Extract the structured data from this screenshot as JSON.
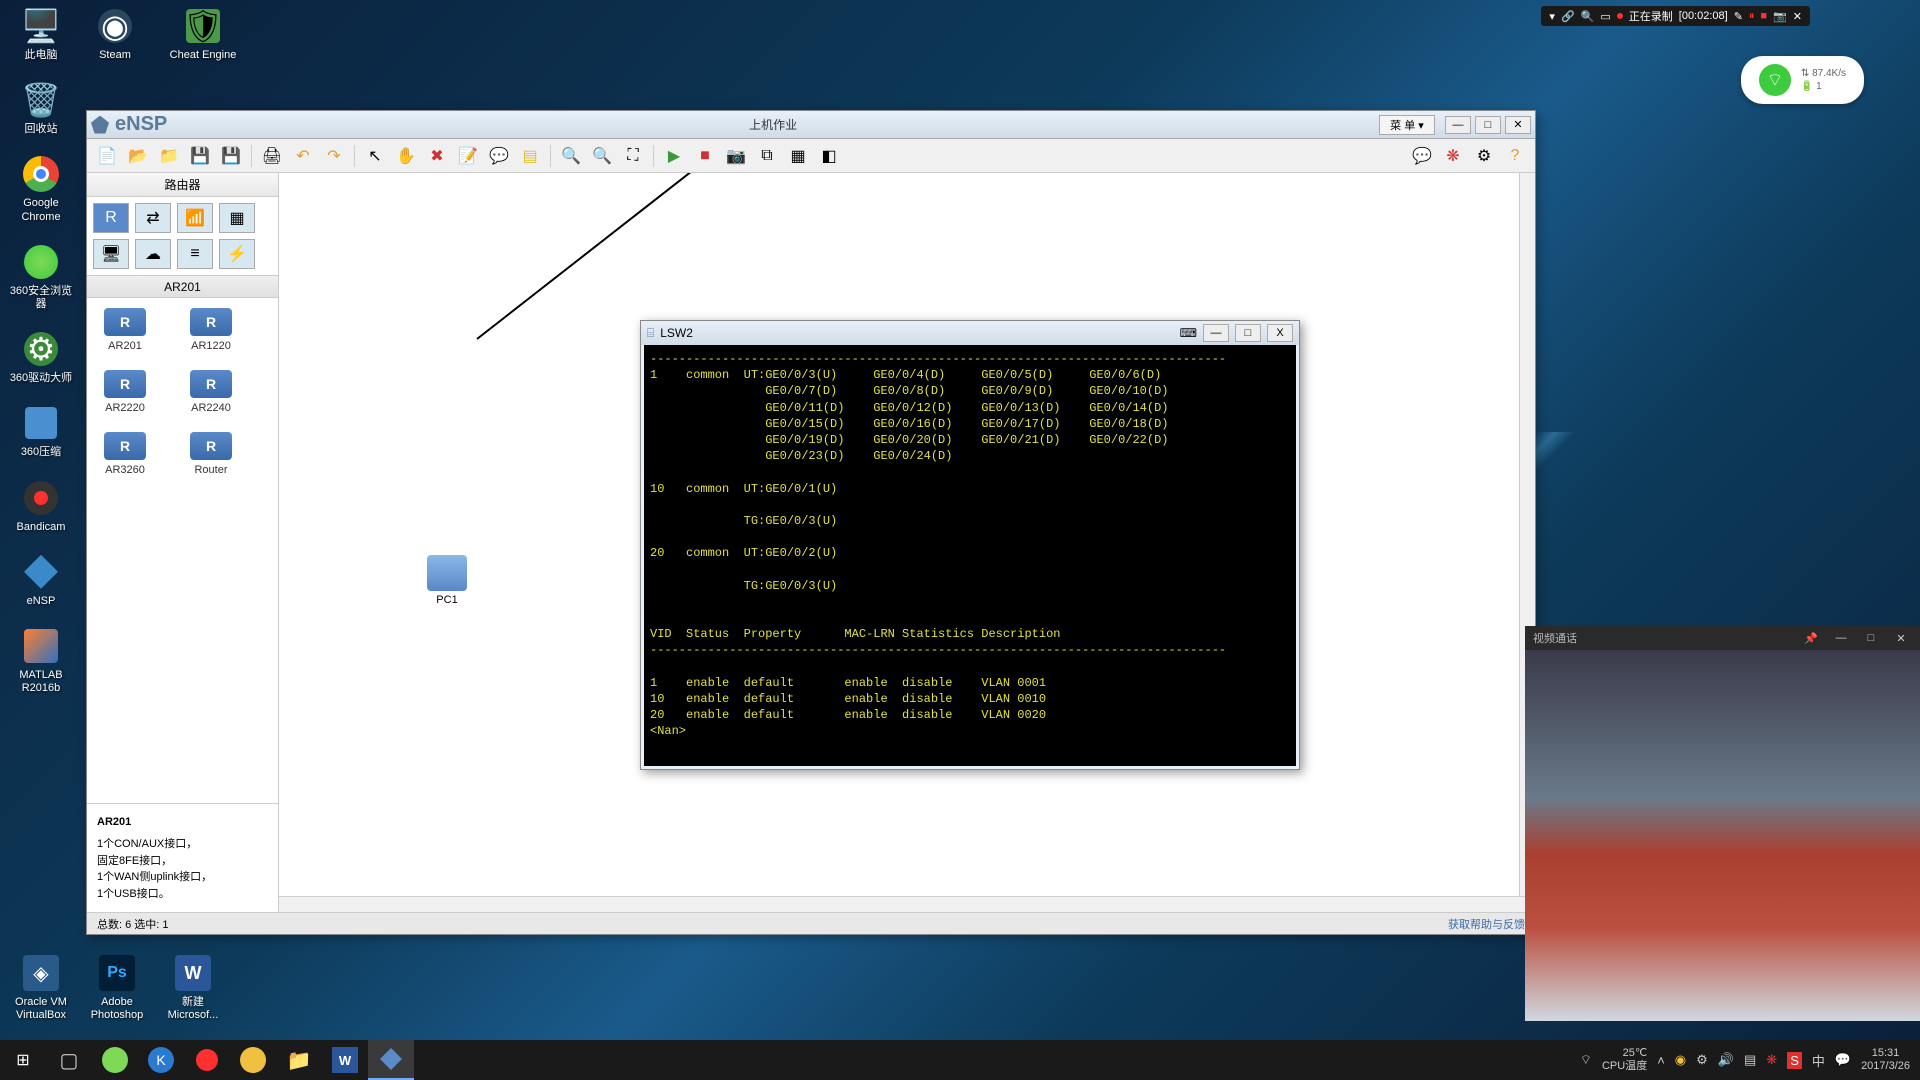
{
  "desktop": {
    "icons_col1": [
      {
        "label": "此电脑",
        "glyph": "🖥️"
      },
      {
        "label": "回收站",
        "glyph": "🗑️"
      },
      {
        "label": "Google Chrome",
        "glyph": "🟡"
      },
      {
        "label": "360安全浏览器",
        "glyph": "🟢"
      },
      {
        "label": "360驱动大师",
        "glyph": "⚙️"
      },
      {
        "label": "360压缩",
        "glyph": "📦"
      },
      {
        "label": "Bandicam",
        "glyph": "🔴"
      },
      {
        "label": "eNSP",
        "glyph": "🔷"
      },
      {
        "label": "MATLAB R2016b",
        "glyph": "📐"
      }
    ],
    "icons_row_top": [
      {
        "label": "Steam",
        "glyph": "⚪"
      },
      {
        "label": "Cheat Engine",
        "glyph": "🛡️"
      }
    ],
    "icons_row_bottom": [
      {
        "label": "Oracle VM VirtualBox",
        "glyph": "📦"
      },
      {
        "label": "Adobe Photoshop",
        "glyph": "Ps"
      },
      {
        "label": "新建 Microsof...",
        "glyph": "W"
      }
    ]
  },
  "recording_bar": {
    "status": "正在录制",
    "time": "[00:02:08]"
  },
  "network_widget": {
    "speed": "87.4K/s",
    "count": "1"
  },
  "ensp": {
    "app_name": "eNSP",
    "title": "上机作业",
    "menu_label": "菜 单 ▾",
    "sidebar": {
      "category": "路由器",
      "device_label": "AR201",
      "devices": [
        {
          "label": "AR201",
          "badge": "R"
        },
        {
          "label": "AR1220",
          "badge": "R"
        },
        {
          "label": "AR2220",
          "badge": "R"
        },
        {
          "label": "AR2240",
          "badge": "R"
        },
        {
          "label": "AR3260",
          "badge": "R"
        },
        {
          "label": "Router",
          "badge": "R"
        }
      ],
      "info_title": "AR201",
      "info_lines": [
        "1个CON/AUX接口，",
        "固定8FE接口，",
        "1个WAN侧uplink接口，",
        "1个USB接口。"
      ]
    },
    "canvas": {
      "pc1_label": "PC1"
    },
    "status_left": "总数: 6  选中: 1",
    "status_right": "获取帮助与反馈"
  },
  "terminal": {
    "title": "LSW2",
    "lines": [
      "--------------------------------------------------------------------------------",
      "1    common  UT:GE0/0/3(U)     GE0/0/4(D)     GE0/0/5(D)     GE0/0/6(D)",
      "                GE0/0/7(D)     GE0/0/8(D)     GE0/0/9(D)     GE0/0/10(D)",
      "                GE0/0/11(D)    GE0/0/12(D)    GE0/0/13(D)    GE0/0/14(D)",
      "                GE0/0/15(D)    GE0/0/16(D)    GE0/0/17(D)    GE0/0/18(D)",
      "                GE0/0/19(D)    GE0/0/20(D)    GE0/0/21(D)    GE0/0/22(D)",
      "                GE0/0/23(D)    GE0/0/24(D)",
      "",
      "10   common  UT:GE0/0/1(U)",
      "",
      "             TG:GE0/0/3(U)",
      "",
      "20   common  UT:GE0/0/2(U)",
      "",
      "             TG:GE0/0/3(U)",
      "",
      "",
      "VID  Status  Property      MAC-LRN Statistics Description",
      "--------------------------------------------------------------------------------",
      "",
      "1    enable  default       enable  disable    VLAN 0001",
      "10   enable  default       enable  disable    VLAN 0010",
      "20   enable  default       enable  disable    VLAN 0020",
      "<Nan>"
    ]
  },
  "webcam": {
    "title": "视频通话"
  },
  "taskbar": {
    "temp": "25℃",
    "temp_label": "CPU温度",
    "time": "15:31",
    "date": "2017/3/26"
  }
}
